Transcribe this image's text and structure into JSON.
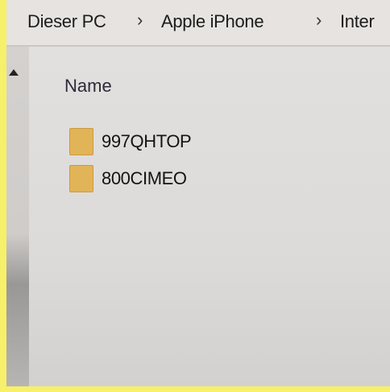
{
  "breadcrumb": {
    "items": [
      "Dieser PC",
      "Apple iPhone",
      "Inter"
    ],
    "separator": "›"
  },
  "list": {
    "column_header": "Name",
    "rows": [
      {
        "name": "997QHTOP",
        "icon": "folder-icon"
      },
      {
        "name": "800CIMEO",
        "icon": "folder-icon"
      }
    ]
  },
  "colors": {
    "photo_border": "#f7f06a",
    "folder": "#e2b458"
  }
}
